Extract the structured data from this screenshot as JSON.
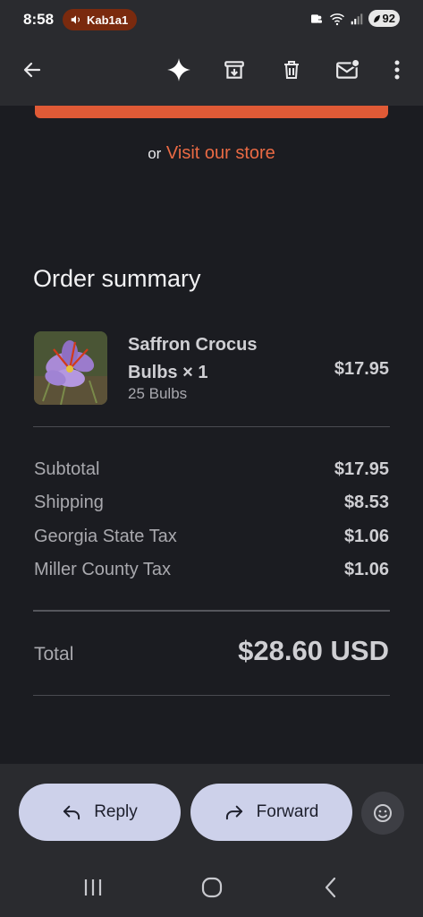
{
  "status_bar": {
    "time": "8:58",
    "call_label": "Kab1a1",
    "battery": "92"
  },
  "toolbar": {
    "back_icon": "arrow-left-icon",
    "gemini_icon": "sparkle-icon",
    "archive_icon": "archive-icon",
    "delete_icon": "trash-icon",
    "mark_unread_icon": "mail-unread-icon",
    "more_icon": "more-vert-icon"
  },
  "content": {
    "store_prefix": "or",
    "store_link": "Visit our store",
    "summary_title": "Order summary",
    "product": {
      "name": "Saffron Crocus Bulbs × 1",
      "variant": "25 Bulbs",
      "price": "$17.95"
    },
    "line_items": [
      {
        "label": "Subtotal",
        "value": "$17.95"
      },
      {
        "label": "Shipping",
        "value": "$8.53"
      },
      {
        "label": "Georgia State Tax",
        "value": "$1.06"
      },
      {
        "label": "Miller County Tax",
        "value": "$1.06"
      }
    ],
    "total_label": "Total",
    "total_value": "$28.60 USD"
  },
  "actions": {
    "reply": "Reply",
    "forward": "Forward"
  },
  "colors": {
    "accent": "#ea6a44",
    "background": "#1b1c21",
    "pill": "#cdd1ea"
  }
}
